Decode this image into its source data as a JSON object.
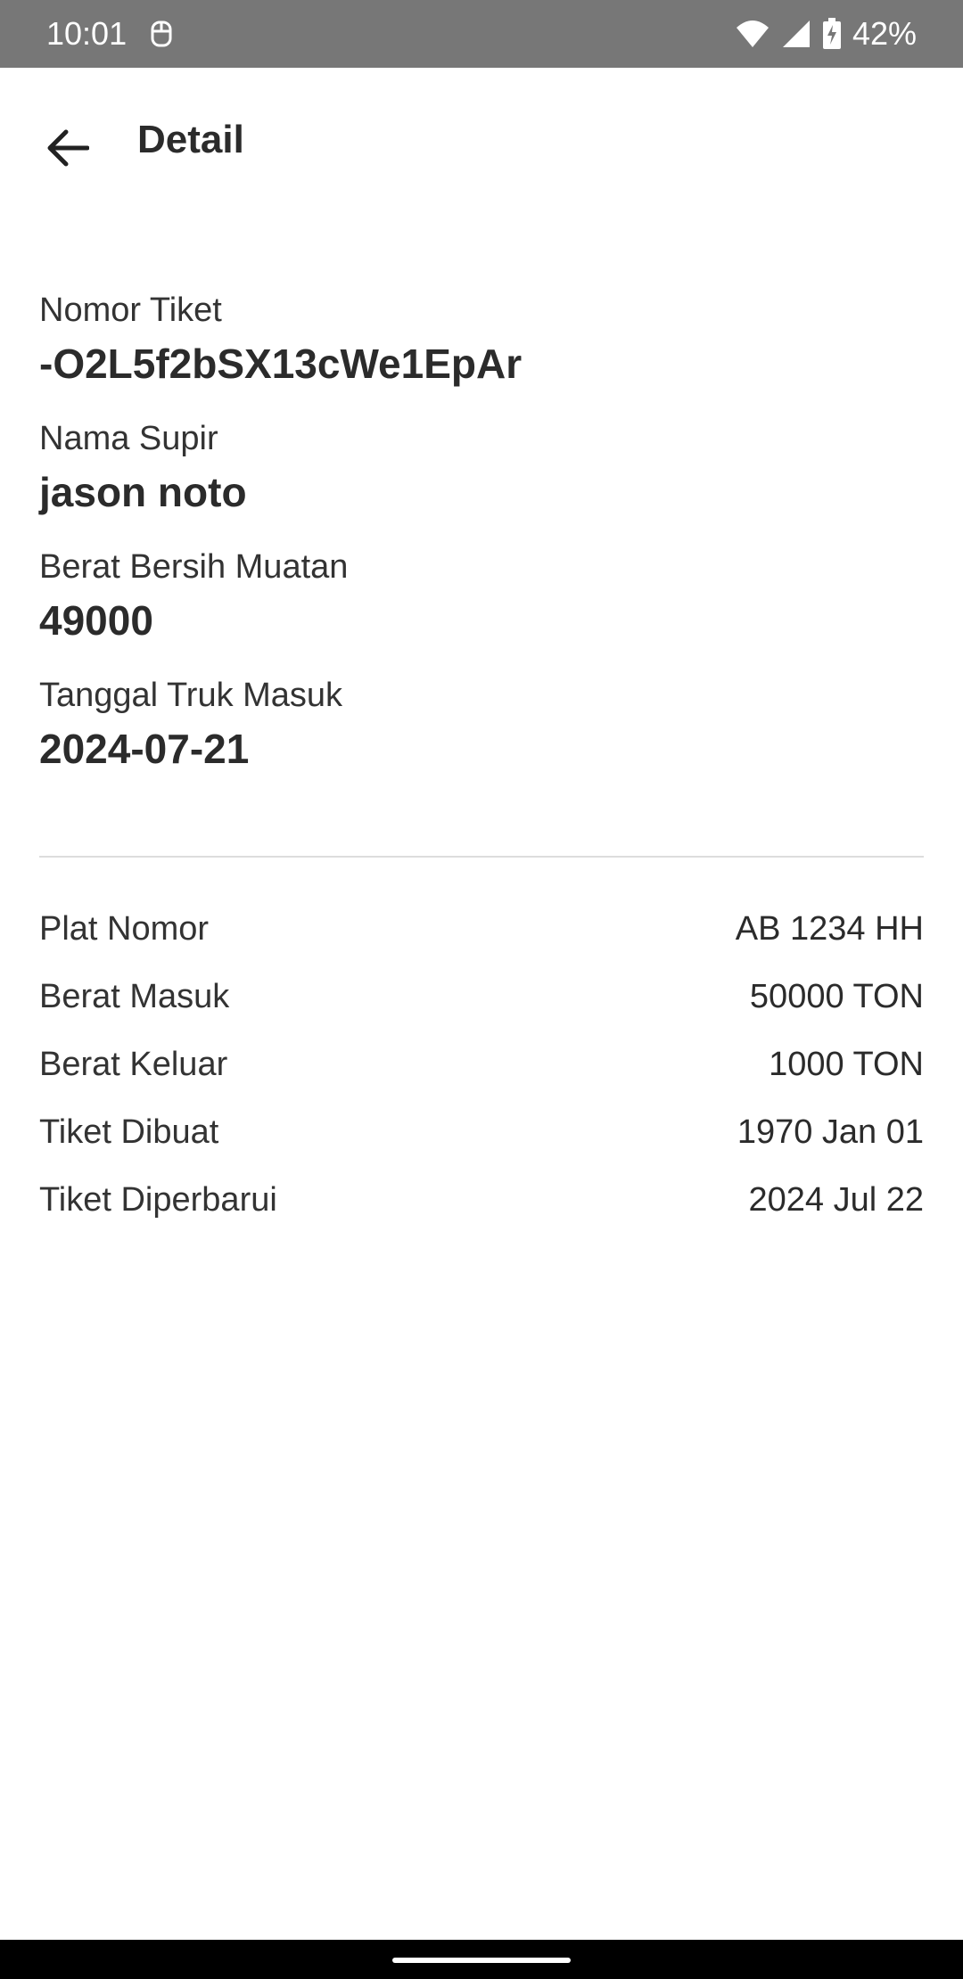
{
  "status_bar": {
    "time": "10:01",
    "battery": "42%"
  },
  "header": {
    "title": "Detail"
  },
  "summary": {
    "ticket_number_label": "Nomor Tiket",
    "ticket_number_value": "-O2L5f2bSX13cWe1EpAr",
    "driver_label": "Nama Supir",
    "driver_value": "jason noto",
    "net_weight_label": "Berat Bersih Muatan",
    "net_weight_value": "49000",
    "entry_date_label": "Tanggal Truk Masuk",
    "entry_date_value": "2024-07-21"
  },
  "details": [
    {
      "label": "Plat Nomor",
      "value": "AB 1234 HH"
    },
    {
      "label": "Berat Masuk",
      "value": "50000 TON"
    },
    {
      "label": "Berat Keluar",
      "value": "1000 TON"
    },
    {
      "label": "Tiket Dibuat",
      "value": "1970 Jan 01"
    },
    {
      "label": "Tiket Diperbarui",
      "value": "2024 Jul 22"
    }
  ],
  "icons": {
    "back": "arrow-back-icon",
    "wifi": "wifi-icon",
    "signal": "signal-icon",
    "battery": "battery-charging-icon",
    "notification": "notification-icon"
  }
}
